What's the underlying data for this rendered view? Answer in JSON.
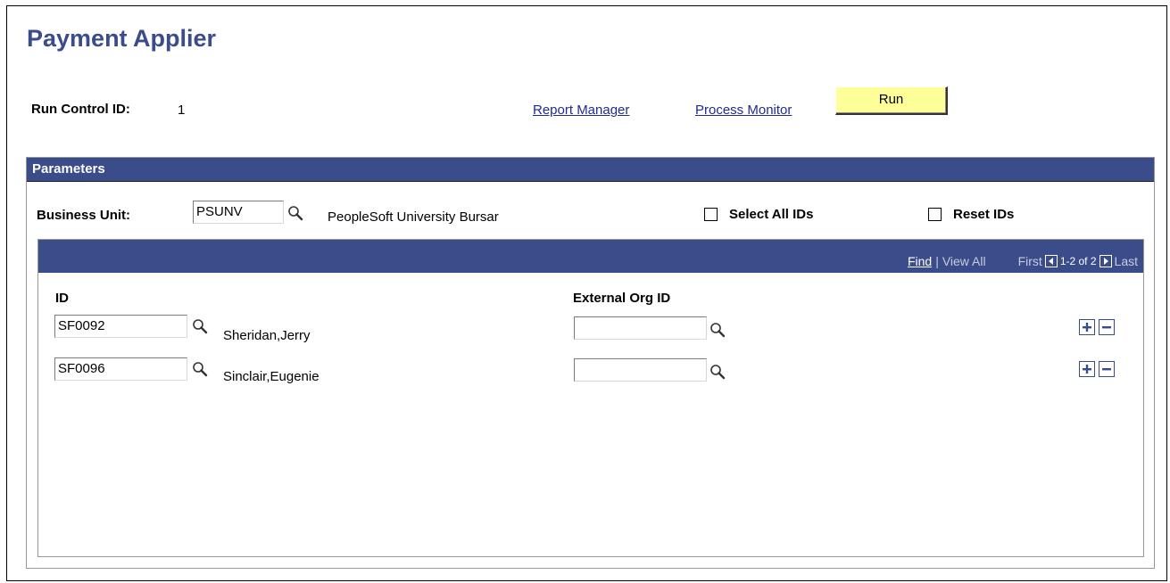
{
  "page": {
    "title": "Payment Applier"
  },
  "run_control": {
    "label": "Run Control ID:",
    "value": "1"
  },
  "links": {
    "report_manager": "Report Manager",
    "process_monitor": "Process Monitor"
  },
  "run_button": {
    "label": "Run"
  },
  "parameters": {
    "header": "Parameters",
    "business_unit": {
      "label": "Business Unit:",
      "value": "PSUNV",
      "description": "PeopleSoft University Bursar"
    },
    "select_all_ids": {
      "label": "Select All IDs",
      "checked": false
    },
    "reset_ids": {
      "label": "Reset IDs",
      "checked": false
    }
  },
  "grid": {
    "nav": {
      "find": "Find",
      "view_all": "View All",
      "first": "First",
      "range": "1-2 of 2",
      "last": "Last"
    },
    "columns": {
      "id": "ID",
      "external_org_id": "External Org ID"
    },
    "rows": [
      {
        "id": "SF0092",
        "name": "Sheridan,Jerry",
        "external_org_id": ""
      },
      {
        "id": "SF0096",
        "name": "Sinclair,Eugenie",
        "external_org_id": ""
      }
    ]
  },
  "colors": {
    "header_bg": "#3b4c8a",
    "title": "#3b4c8a",
    "run_button_bg": "#ffff99",
    "link": "#1f2b8f"
  }
}
